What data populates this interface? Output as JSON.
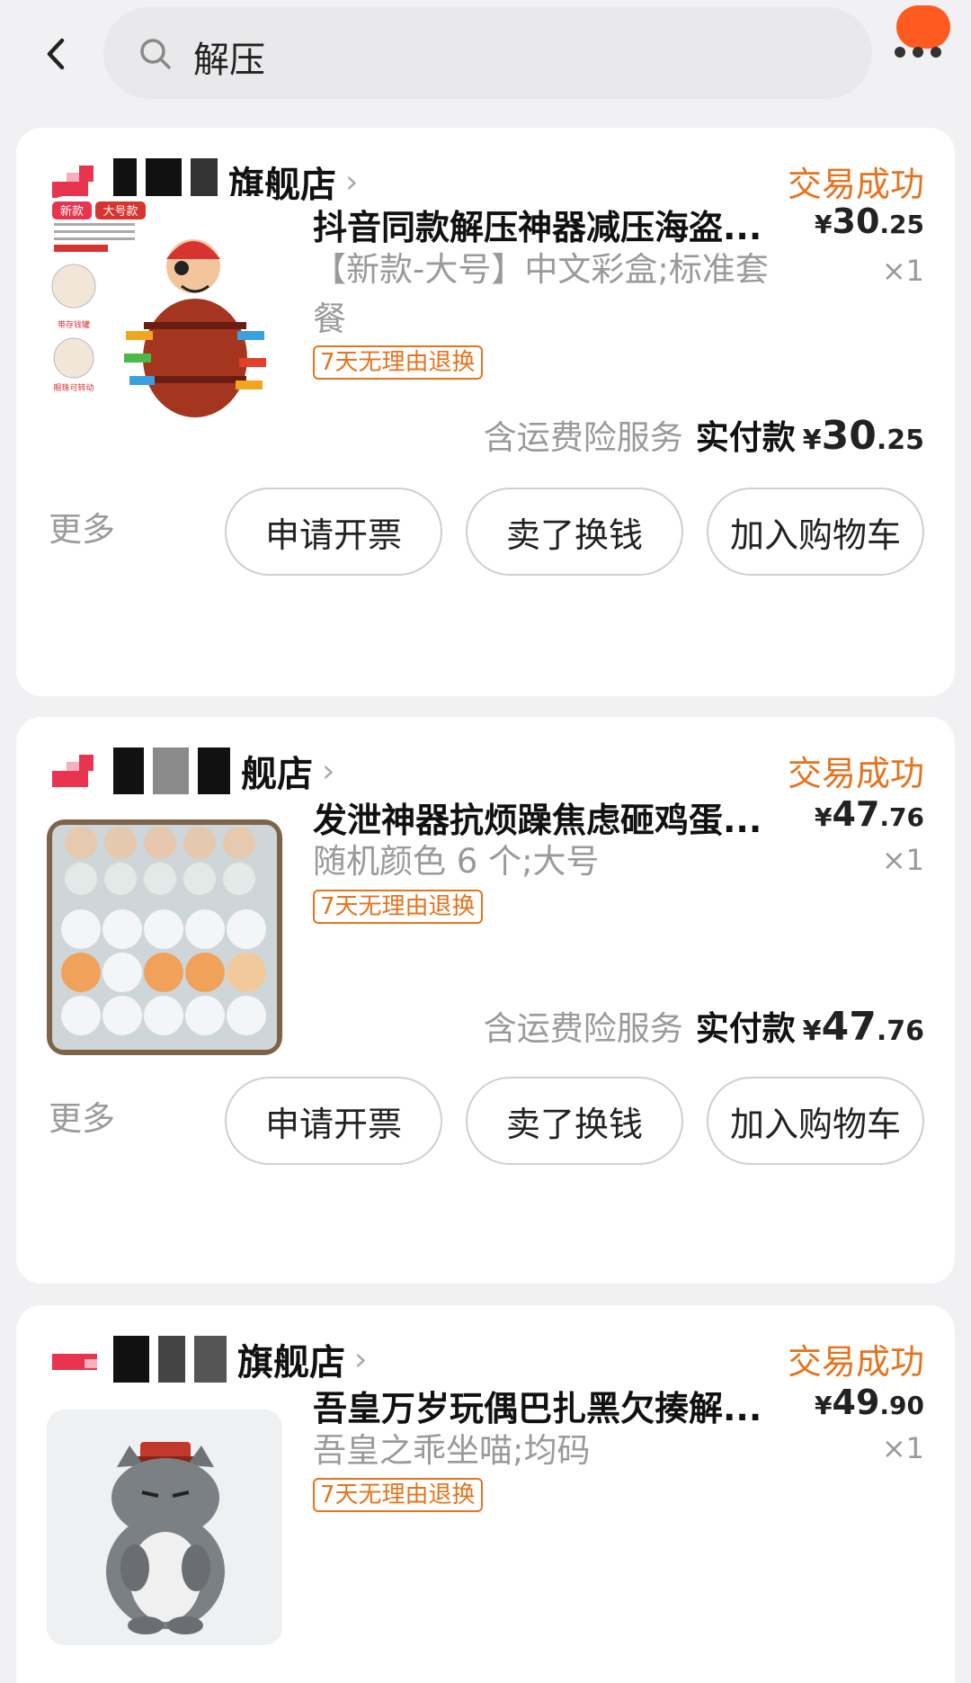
{
  "search": {
    "query": "解压"
  },
  "orders": [
    {
      "shop_name": "旗舰店",
      "status": "交易成功",
      "title": "抖音同款解压神器减压海盗...",
      "price_currency": "¥",
      "price_int": "30",
      "price_dec": ".25",
      "spec": "【新款-大号】中文彩盒;标准套餐",
      "qty": "×1",
      "tag": "7天无理由退换",
      "insurance": "含运费险服务",
      "pay_label": "实付款",
      "pay_currency": "¥",
      "pay_int": "30",
      "pay_dec": ".25",
      "more": "更多",
      "btn_invoice": "申请开票",
      "btn_sell": "卖了换钱",
      "btn_cart": "加入购物车",
      "thumb_text": [
        "新款",
        "大号款",
        "带存钱罐",
        "眼珠可转动"
      ]
    },
    {
      "shop_name": "舰店",
      "status": "交易成功",
      "title": "发泄神器抗烦躁焦虑砸鸡蛋...",
      "price_currency": "¥",
      "price_int": "47",
      "price_dec": ".76",
      "spec": "随机颜色 6 个;大号",
      "qty": "×1",
      "tag": "7天无理由退换",
      "insurance": "含运费险服务",
      "pay_label": "实付款",
      "pay_currency": "¥",
      "pay_int": "47",
      "pay_dec": ".76",
      "more": "更多",
      "btn_invoice": "申请开票",
      "btn_sell": "卖了换钱",
      "btn_cart": "加入购物车"
    },
    {
      "shop_name": "旗舰店",
      "status": "交易成功",
      "title": "吾皇万岁玩偶巴扎黑欠揍解...",
      "price_currency": "¥",
      "price_int": "49",
      "price_dec": ".90",
      "spec": "吾皇之乖坐喵;均码",
      "qty": "×1",
      "tag": "7天无理由退换"
    }
  ],
  "colors": {
    "accent": "#e4741f",
    "badge": "#ff5a1f",
    "brand": "#e8344e"
  }
}
